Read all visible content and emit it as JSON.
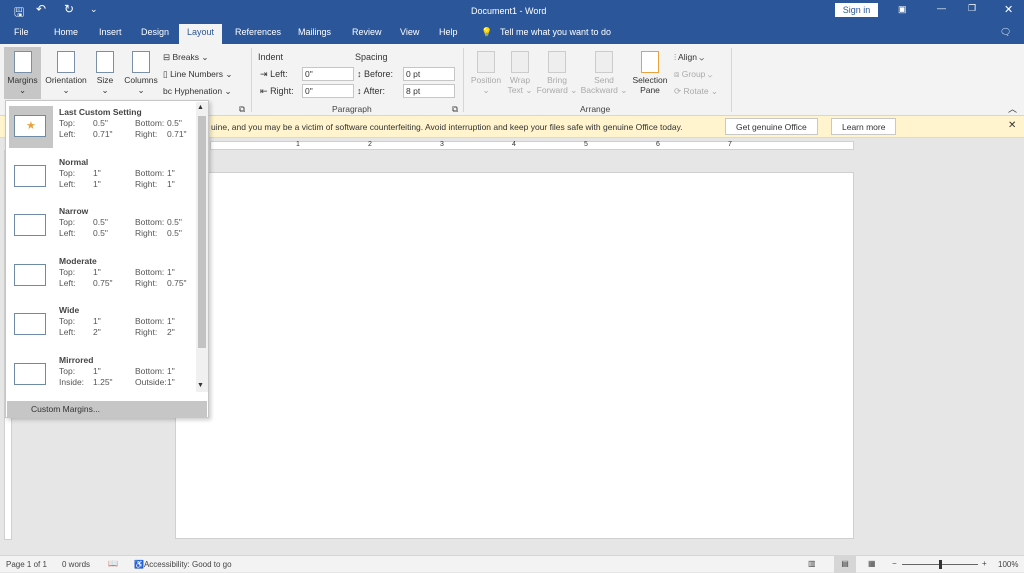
{
  "titlebar": {
    "title": "Document1 - Word",
    "sign_in": "Sign in",
    "icons": [
      "save-icon",
      "undo-icon",
      "redo-icon",
      "customize-qat-icon",
      "ribbon-display-icon",
      "minimize-icon",
      "restore-icon",
      "close-icon"
    ]
  },
  "tabs": [
    "File",
    "Home",
    "Insert",
    "Design",
    "Layout",
    "References",
    "Mailings",
    "Review",
    "View",
    "Help"
  ],
  "tell_me": "Tell me what you want to do",
  "ribbon": {
    "page_setup": {
      "margins": "Margins",
      "orientation": "Orientation",
      "size": "Size",
      "columns": "Columns",
      "breaks": "Breaks",
      "line_numbers": "Line Numbers",
      "hyphenation": "Hyphenation"
    },
    "paragraph": {
      "group": "Paragraph",
      "indent": "Indent",
      "spacing": "Spacing",
      "left_label": "Left:",
      "right_label": "Right:",
      "before_label": "Before:",
      "after_label": "After:",
      "left": "0\"",
      "right": "0\"",
      "before": "0 pt",
      "after": "8 pt"
    },
    "arrange": {
      "group": "Arrange",
      "position": "Position",
      "wrap1": "Wrap",
      "wrap2": "Text",
      "bring1": "Bring",
      "bring2": "Forward",
      "send1": "Send",
      "send2": "Backward",
      "sel1": "Selection",
      "sel2": "Pane",
      "align": "Align",
      "group_btn": "Group",
      "rotate": "Rotate"
    }
  },
  "message": {
    "text": "uine, and you may be a victim of software counterfeiting. Avoid interruption and keep your files safe with genuine Office today.",
    "get": "Get genuine Office",
    "learn": "Learn more"
  },
  "ruler": [
    "1",
    "2",
    "3",
    "4",
    "5",
    "6",
    "7"
  ],
  "margins_menu": {
    "items": [
      {
        "name": "Last Custom Setting",
        "l1": "Top:",
        "v1": "0.5\"",
        "l2": "Bottom:",
        "v2": "0.5\"",
        "l3": "Left:",
        "v3": "0.71\"",
        "l4": "Right:",
        "v4": "0.71\""
      },
      {
        "name": "Normal",
        "l1": "Top:",
        "v1": "1\"",
        "l2": "Bottom:",
        "v2": "1\"",
        "l3": "Left:",
        "v3": "1\"",
        "l4": "Right:",
        "v4": "1\""
      },
      {
        "name": "Narrow",
        "l1": "Top:",
        "v1": "0.5\"",
        "l2": "Bottom:",
        "v2": "0.5\"",
        "l3": "Left:",
        "v3": "0.5\"",
        "l4": "Right:",
        "v4": "0.5\""
      },
      {
        "name": "Moderate",
        "l1": "Top:",
        "v1": "1\"",
        "l2": "Bottom:",
        "v2": "1\"",
        "l3": "Left:",
        "v3": "0.75\"",
        "l4": "Right:",
        "v4": "0.75\""
      },
      {
        "name": "Wide",
        "l1": "Top:",
        "v1": "1\"",
        "l2": "Bottom:",
        "v2": "1\"",
        "l3": "Left:",
        "v3": "2\"",
        "l4": "Right:",
        "v4": "2\""
      },
      {
        "name": "Mirrored",
        "l1": "Top:",
        "v1": "1\"",
        "l2": "Bottom:",
        "v2": "1\"",
        "l3": "Inside:",
        "v3": "1.25\"",
        "l4": "Outside:",
        "v4": "1\""
      }
    ],
    "custom": "Custom Margins..."
  },
  "status": {
    "page": "Page 1 of 1",
    "words": "0 words",
    "accessibility": "Accessibility: Good to go",
    "zoom": "100%",
    "zoom_percent": 100
  }
}
